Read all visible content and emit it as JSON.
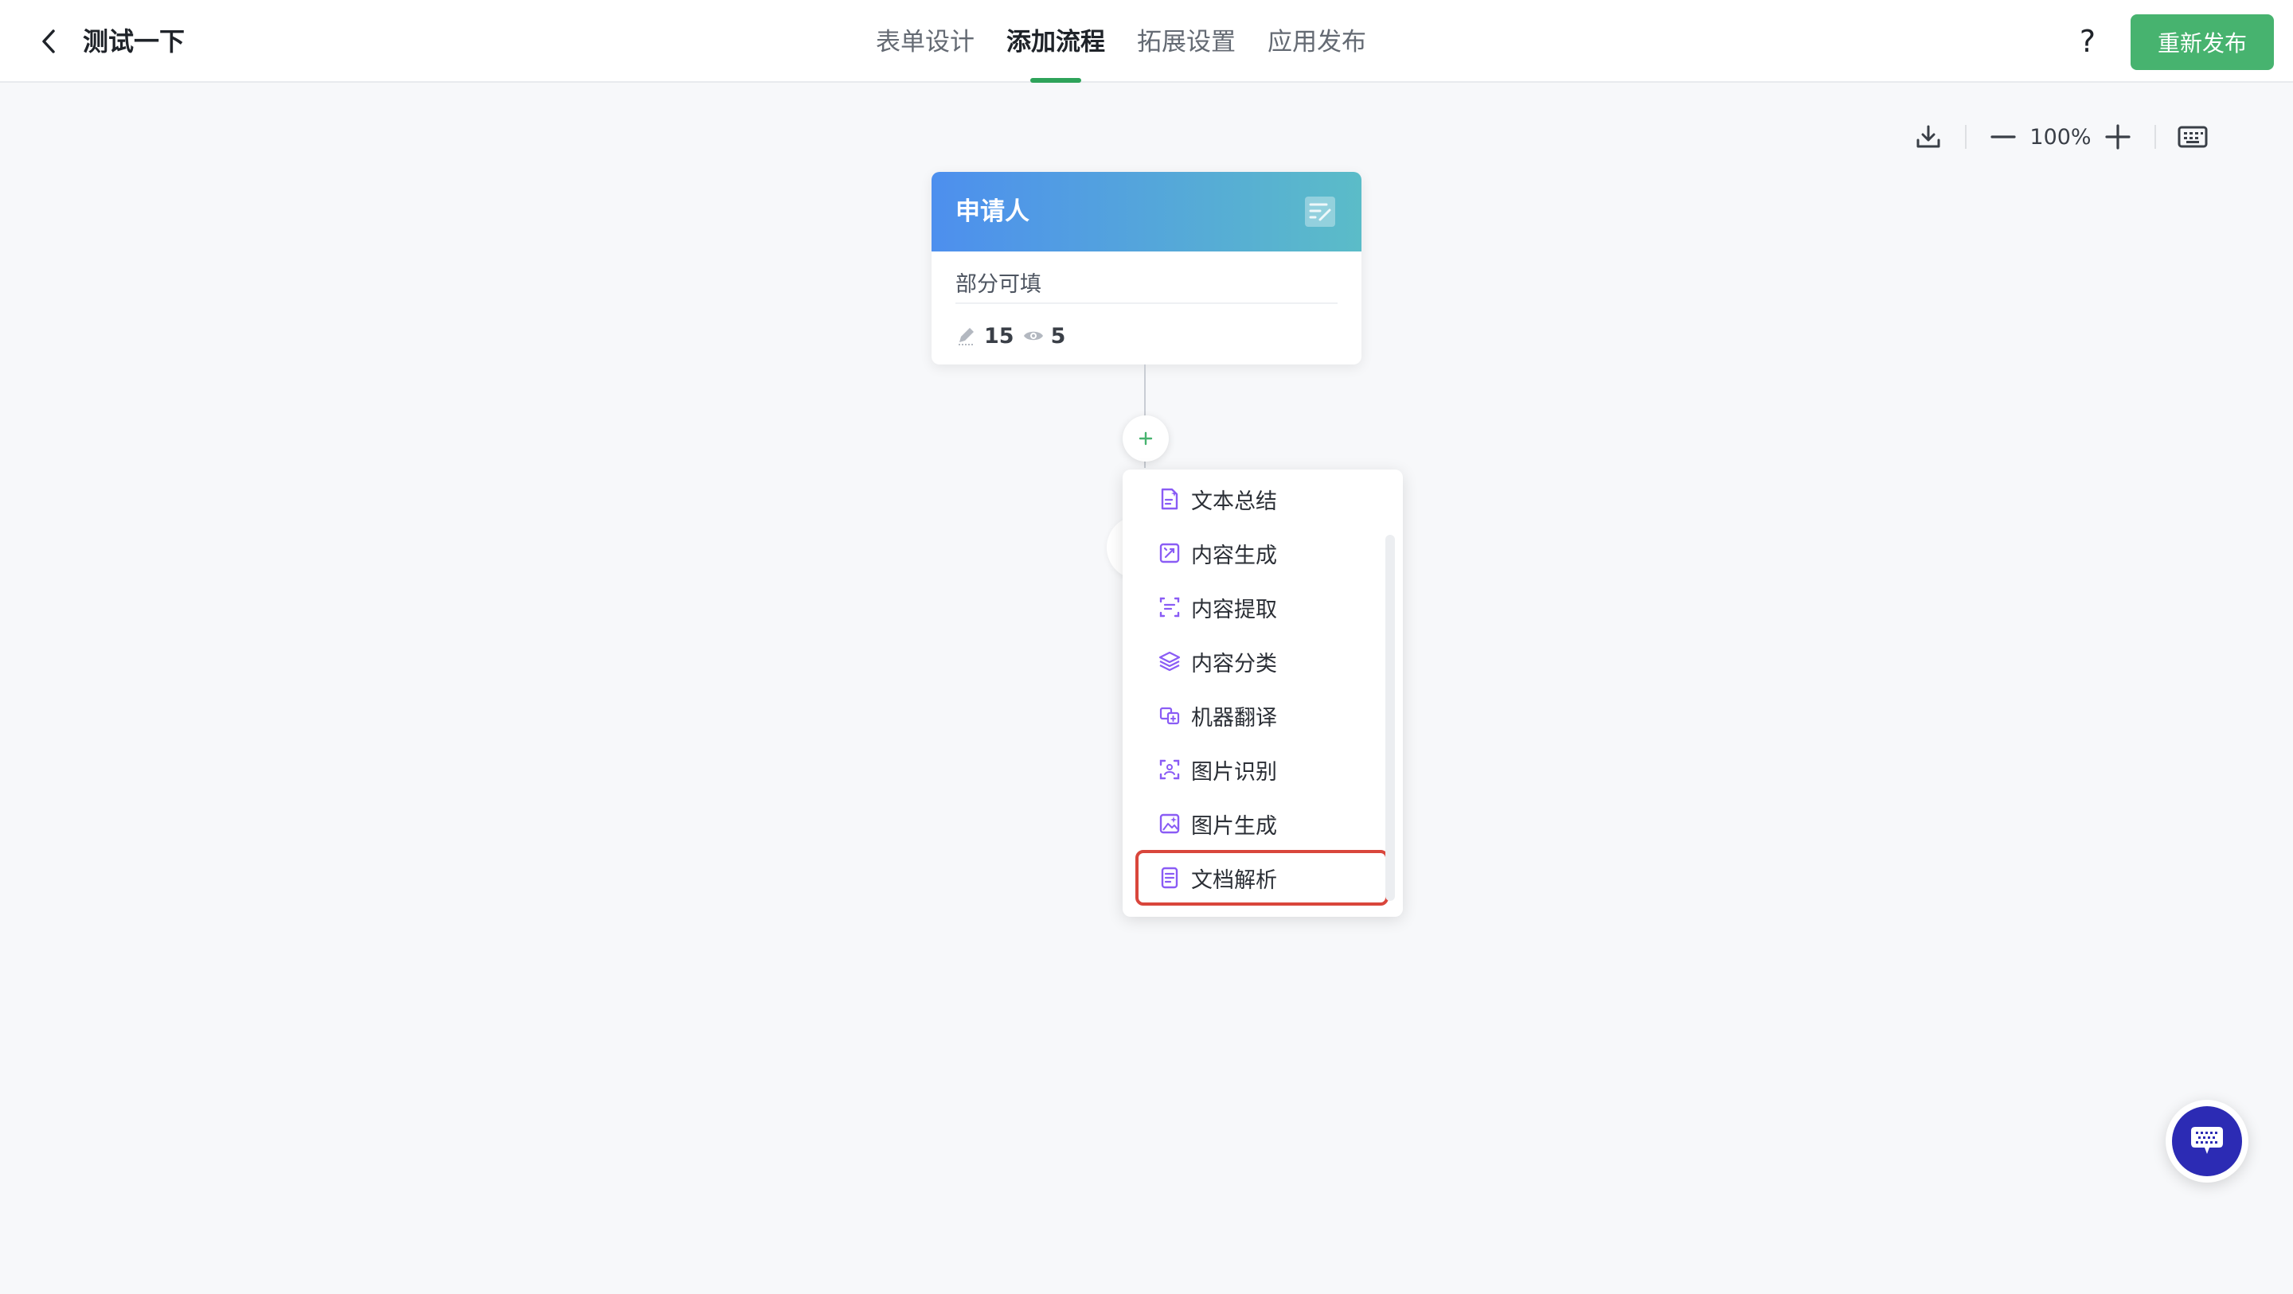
{
  "header": {
    "title": "测试一下",
    "tabs": [
      {
        "label": "表单设计",
        "active": false
      },
      {
        "label": "添加流程",
        "active": true
      },
      {
        "label": "拓展设置",
        "active": false
      },
      {
        "label": "应用发布",
        "active": false
      }
    ],
    "help_label": "?",
    "publish_label": "重新发布"
  },
  "toolbar": {
    "zoom": "100%",
    "icons": [
      "download-icon",
      "zoom-out-icon",
      "zoom-in-icon",
      "keyboard-icon"
    ]
  },
  "node": {
    "title": "申请人",
    "subtitle": "部分可填",
    "edit_count": "15",
    "view_count": "5"
  },
  "menu": {
    "items": [
      {
        "label": "文本总结",
        "icon": "text-summary-icon"
      },
      {
        "label": "内容生成",
        "icon": "content-generate-icon"
      },
      {
        "label": "内容提取",
        "icon": "content-extract-icon"
      },
      {
        "label": "内容分类",
        "icon": "layers-icon"
      },
      {
        "label": "机器翻译",
        "icon": "translate-icon"
      },
      {
        "label": "图片识别",
        "icon": "image-scan-icon"
      },
      {
        "label": "图片生成",
        "icon": "image-generate-icon"
      },
      {
        "label": "文档解析",
        "icon": "document-parse-icon",
        "highlighted": true
      }
    ]
  },
  "colors": {
    "accent": "#47b36f",
    "highlight": "#d9463c",
    "menu_icon": "#8a5cf5",
    "node_gradient_start": "#4d8fee",
    "node_gradient_end": "#5bbcc8"
  }
}
